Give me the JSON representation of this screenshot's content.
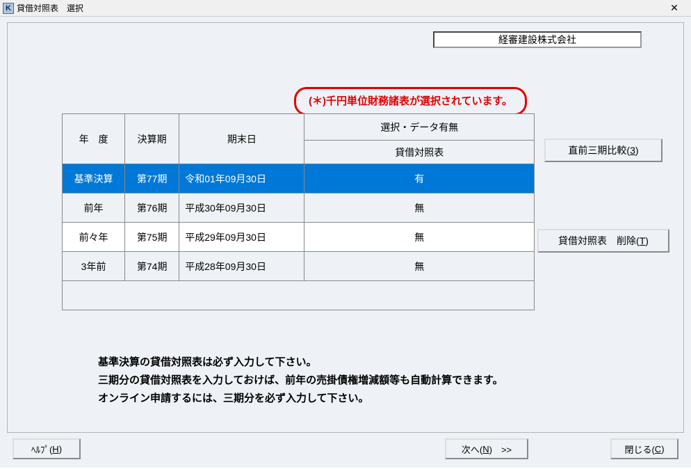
{
  "window": {
    "icon_letter": "K",
    "title": "貸借対照表　選択"
  },
  "company_name": "経審建設株式会社",
  "notice": "(＊)千円単位財務諸表が選択されています。",
  "table": {
    "headers": {
      "year": "年　度",
      "term": "決算期",
      "end_date": "期末日",
      "select_group": "選択・データ有無",
      "balance_sheet": "貸借対照表"
    },
    "rows": [
      {
        "year": "基準決算",
        "term": "第77期",
        "end_date": "令和01年09月30日",
        "status": "有",
        "selected": true
      },
      {
        "year": "前年",
        "term": "第76期",
        "end_date": "平成30年09月30日",
        "status": "無",
        "selected": false
      },
      {
        "year": "前々年",
        "term": "第75期",
        "end_date": "平成29年09月30日",
        "status": "無",
        "selected": false
      },
      {
        "year": "3年前",
        "term": "第74期",
        "end_date": "平成28年09月30日",
        "status": "無",
        "selected": false
      }
    ]
  },
  "buttons": {
    "compare3": {
      "label_prefix": "直前三期比較(",
      "hotkey": "3",
      "label_suffix": ")"
    },
    "delete_bs": {
      "label_prefix": "貸借対照表　削除(",
      "hotkey": "T",
      "label_suffix": ")"
    },
    "help": {
      "label_prefix": "ﾍﾙﾌﾟ(",
      "hotkey": "H",
      "label_suffix": ")"
    },
    "next": {
      "label_prefix": "次へ(",
      "hotkey": "N",
      "label_suffix": ")　>>"
    },
    "close": {
      "label_prefix": "閉じる(",
      "hotkey": "C",
      "label_suffix": ")"
    }
  },
  "instructions": {
    "line1": "基準決算の貸借対照表は必ず入力して下さい。",
    "line2": "三期分の貸借対照表を入力しておけば、前年の売掛債権増減額等も自動計算できます。",
    "line3": "オンライン申請するには、三期分を必ず入力して下さい。"
  }
}
